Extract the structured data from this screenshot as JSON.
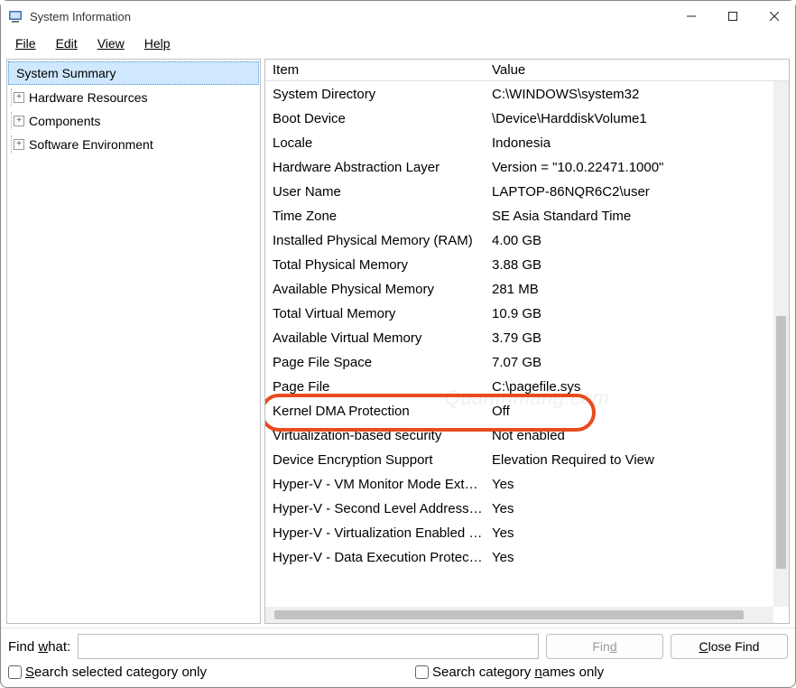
{
  "window": {
    "title": "System Information"
  },
  "menu": {
    "file": "File",
    "edit": "Edit",
    "view": "View",
    "help": "Help"
  },
  "tree": {
    "root": "System Summary",
    "items": [
      "Hardware Resources",
      "Components",
      "Software Environment"
    ]
  },
  "columns": {
    "item": "Item",
    "value": "Value"
  },
  "rows": [
    {
      "item": "System Directory",
      "value": "C:\\WINDOWS\\system32"
    },
    {
      "item": "Boot Device",
      "value": "\\Device\\HarddiskVolume1"
    },
    {
      "item": "Locale",
      "value": "Indonesia"
    },
    {
      "item": "Hardware Abstraction Layer",
      "value": "Version = \"10.0.22471.1000\""
    },
    {
      "item": "User Name",
      "value": "LAPTOP-86NQR6C2\\user"
    },
    {
      "item": "Time Zone",
      "value": "SE Asia Standard Time"
    },
    {
      "item": "Installed Physical Memory (RAM)",
      "value": "4.00 GB"
    },
    {
      "item": "Total Physical Memory",
      "value": "3.88 GB"
    },
    {
      "item": "Available Physical Memory",
      "value": "281 MB"
    },
    {
      "item": "Total Virtual Memory",
      "value": "10.9 GB"
    },
    {
      "item": "Available Virtual Memory",
      "value": "3.79 GB"
    },
    {
      "item": "Page File Space",
      "value": "7.07 GB"
    },
    {
      "item": "Page File",
      "value": "C:\\pagefile.sys"
    },
    {
      "item": "Kernel DMA Protection",
      "value": "Off"
    },
    {
      "item": "Virtualization-based security",
      "value": "Not enabled"
    },
    {
      "item": "Device Encryption Support",
      "value": "Elevation Required to View"
    },
    {
      "item": "Hyper-V - VM Monitor Mode Extensions",
      "value": "Yes"
    },
    {
      "item": "Hyper-V - Second Level Address Translation Extensions",
      "value": "Yes"
    },
    {
      "item": "Hyper-V - Virtualization Enabled in Firmware",
      "value": "Yes"
    },
    {
      "item": "Hyper-V - Data Execution Protection",
      "value": "Yes"
    }
  ],
  "highlight_row_index": 14,
  "watermark": "Quantrimang.com",
  "find": {
    "label_prefix": "Find ",
    "label_ul": "w",
    "label_suffix": "hat:",
    "value": "",
    "find_btn_ul": "d",
    "find_btn_prefix": "Fin",
    "close_btn_ul": "C",
    "close_btn_suffix": "lose Find",
    "chk1_ul": "S",
    "chk1_suffix": "earch selected category only",
    "chk2_prefix": "Search category ",
    "chk2_ul": "n",
    "chk2_suffix": "ames only"
  }
}
